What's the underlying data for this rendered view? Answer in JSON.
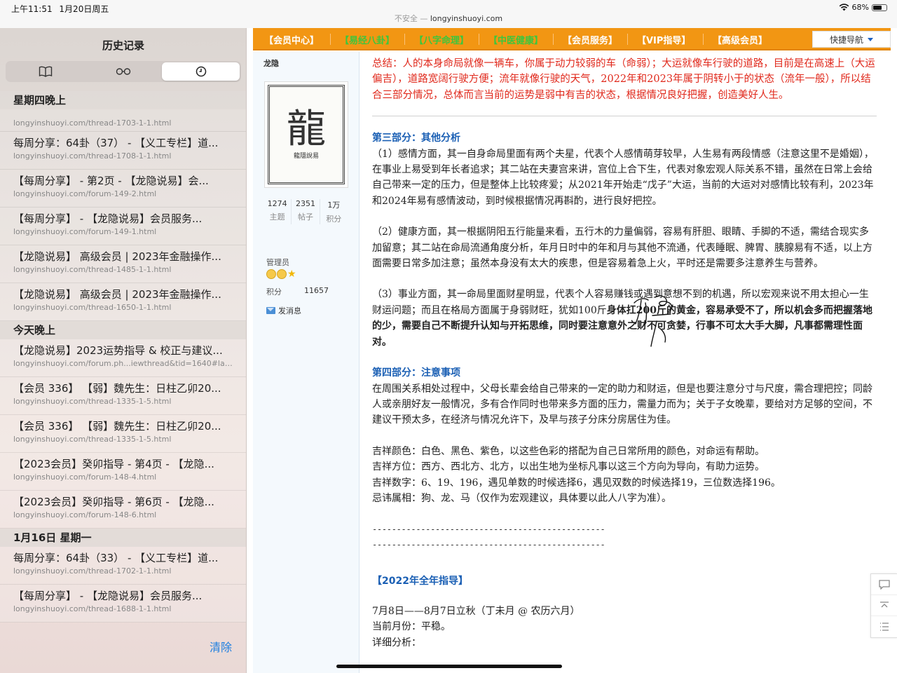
{
  "status_bar": {
    "time": "上午11:51",
    "date": "1月20日周五",
    "insecure_label": "不安全 —",
    "url": "longyinshuoyi.com",
    "battery_text": "68%",
    "battery_level": 0.68
  },
  "sidebar": {
    "title": "历史记录",
    "tabs": [
      "bookmarks",
      "reading-list",
      "history"
    ],
    "clear_label": "清除",
    "groups": [
      {
        "day": "星期四晚上",
        "items": [
          {
            "title": "",
            "url": "longyinshuoyi.com/thread-1703-1-1.html"
          },
          {
            "title": "每周分享：64卦（37） - 【义工专栏】道...",
            "url": "longyinshuoyi.com/thread-1708-1-1.html"
          },
          {
            "title": "【每周分享】 - 第2页 - 【龙隐说易】会...",
            "url": "longyinshuoyi.com/forum-149-2.html"
          },
          {
            "title": "【每周分享】 - 【龙隐说易】会员服务...",
            "url": "longyinshuoyi.com/forum-149-1.html"
          },
          {
            "title": "【龙隐说易】 高级会员 | 2023年金融操作...",
            "url": "longyinshuoyi.com/thread-1485-1-1.html"
          },
          {
            "title": "【龙隐说易】 高级会员 | 2023年金融操作...",
            "url": "longyinshuoyi.com/thread-1650-1-1.html"
          }
        ]
      },
      {
        "day": "今天晚上",
        "items": [
          {
            "title": "【龙隐说易】2023运势指导 & 校正与建议...",
            "url": "longyinshuoyi.com/forum.ph...iewthread&tid=1640#lastpost"
          },
          {
            "title": "【会员 336】 【弱】魏先生：日柱乙卯20...",
            "url": "longyinshuoyi.com/thread-1335-1-5.html"
          },
          {
            "title": "【会员 336】 【弱】魏先生：日柱乙卯20...",
            "url": "longyinshuoyi.com/thread-1335-1-5.html"
          },
          {
            "title": "【2023会员】癸卯指导 - 第4页 - 【龙隐...",
            "url": "longyinshuoyi.com/forum-148-4.html"
          },
          {
            "title": "【2023会员】癸卯指导 - 第6页 - 【龙隐...",
            "url": "longyinshuoyi.com/forum-148-6.html"
          }
        ]
      },
      {
        "day": "1月16日 星期一",
        "items": [
          {
            "title": "每周分享：64卦（33） - 【义工专栏】道...",
            "url": "longyinshuoyi.com/thread-1702-1-1.html"
          },
          {
            "title": "【每周分享】 - 【龙隐说易】会员服务...",
            "url": "longyinshuoyi.com/thread-1688-1-1.html"
          }
        ]
      }
    ]
  },
  "navbar": {
    "items": [
      {
        "label": "【会员中心】",
        "color": "white"
      },
      {
        "label": "【易经八卦】",
        "color": "green"
      },
      {
        "label": "【八字命理】",
        "color": "green"
      },
      {
        "label": "【中医健康】",
        "color": "green"
      },
      {
        "label": "【会员服务】",
        "color": "white"
      },
      {
        "label": "【VIP指导】",
        "color": "white"
      },
      {
        "label": "【高级会员】",
        "color": "white"
      }
    ],
    "quick_nav": "快捷导航"
  },
  "author": {
    "name": "龙隐",
    "avatar_seal_char": "龍",
    "avatar_seal_caption": "龍隱說易",
    "stats": [
      {
        "value": "1274",
        "label": "主题"
      },
      {
        "value": "2351",
        "label": "帖子"
      },
      {
        "value": "1万",
        "label": "积分"
      }
    ],
    "role": "管理员",
    "points_label": "积分",
    "points_value": "11657",
    "send_message": "发消息"
  },
  "post": {
    "summary": "总结：人的本身命局就像一辆车，你属于动力较弱的车（命弱）；大运就像车行驶的道路，目前是在高速上（大运偏吉），道路宽阔行驶方便；流年就像行驶的天气，2022年和2023年属于阴转小于的状态（流年一般），所以结合三部分情况，总体而言当前的运势是弱中有吉的状态，根据情况良好把握，创造美好人生。",
    "part3_head": "第三部分：其他分析",
    "p1": "（1）感情方面，其一自身命局里面有两个夫星，代表个人感情萌芽较早，人生易有两段情感（注意这里不是婚姻），在事业上易受到年长者追求；其二站在夫妻宫来讲，宫位上合下生，代表对象宏观人际关系不错，虽然在日常上会给自己带来一定的压力，但是整体上比较疼爱；从2021年开始走“戊子”大运，当前的大运对对感情比较有利，2023年和2024年易有感情波动，到时候根据情况再斟酌，进行良好把控。",
    "p2": "（2）健康方面，其一根据阴阳五行能量来看，五行木的力量偏弱，容易有肝胆、眼睛、手脚的不适，需结合现实多加留意；其二站在命局流通角度分析，年月日时中的年和月与其他不流通，代表睡眠、脾胃、胰腺易有不适，以上方面需要日常多加注意；虽然本身没有太大的疾患，但是容易着急上火，平时还是需要多注意养生与营养。",
    "p3a": "（3）事业方面，其一命局里面财星明显，代表个人容易赚钱或遇到意想不到的机遇，所以宏观来说不用太担心一生财运问题；而且在格局方面属于身弱财旺，犹如100斤",
    "p3b": "身体扛200斤的黄金，容易承受不了，所以机会多而把握落地的少，需要自己不断提升认知与开拓思维，同时要注意意外之财不可贪婪，行事不可太大手大脚，凡事都需理性面对。",
    "part4_head": "第四部分：注意事项",
    "p4": "在周围关系相处过程中，父母长辈会给自己带来的一定的助力和财运，但是也要注意分寸与尺度，需合理把控；同龄人或亲朋好友一般情况，多有合作同时也带来多方面的压力，需量力而为；关于子女晚辈，要给对方足够的空间，不建议干预太多，在经济与情况允许下，及早与孩子分床分房居住为佳。",
    "lucky_color": "吉祥颜色：白色、黑色、紫色，以这些色彩的搭配为自己日常所用的颜色，对命运有帮助。",
    "lucky_direction": "吉祥方位：西方、西北方、北方，以出生地为坐标凡事以这三个方向为导向，有助力运势。",
    "lucky_number": "吉祥数字：6、19、196，遇见单数的时候选择6，遇见双数的时候选择19，三位数选择196。",
    "taboo_zodiac": "忌讳属相：狗、龙、马（仅作为宏观建议，具体要以此人八字为准）。",
    "dash1": "------------------------------------------------",
    "dash2": "------------------------------------------------",
    "year_head": "【2022年全年指导】",
    "month_range": "7月8日——8月7日立秋（丁未月 @ 农历六月）",
    "current_month": "当前月份：平稳。",
    "detail_cut": "详细分析："
  }
}
